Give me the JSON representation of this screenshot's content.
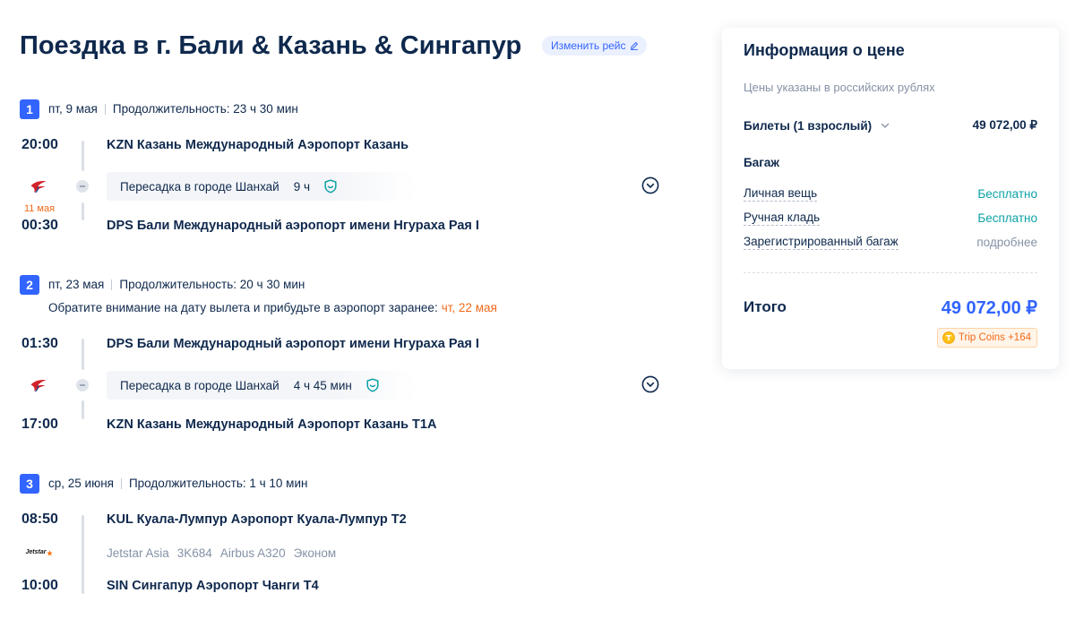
{
  "colors": {
    "text": "#0f294d",
    "muted": "#8592a6",
    "accent": "#3264ff",
    "free": "#0ba1a5",
    "warning": "#f06a1b",
    "line": "#dadfe6"
  },
  "header": {
    "title": "Поездка в г. Бали & Казань & Сингапур",
    "change_flight": "Изменить рейс",
    "change_flight_icon": "pencil-icon"
  },
  "segments": [
    {
      "number": "1",
      "date": "пт, 9 мая",
      "duration": "Продолжительность: 23 ч 30 мин",
      "departure": {
        "time": "20:00",
        "airport": "KZN Казань Международный Аэропорт Казань"
      },
      "airline_logo": "china-eastern-logo",
      "arrival_date_note": "11 мая",
      "layover": {
        "label": "Пересадка в городе Шанхай",
        "duration": "9 ч",
        "icon": "shield-icon"
      },
      "arrival": {
        "time": "00:30",
        "airport": "DPS Бали Международный аэропорт имени Нгураха Рая I"
      }
    },
    {
      "number": "2",
      "date": "пт, 23 мая",
      "duration": "Продолжительность: 20 ч 30 мин",
      "notice": {
        "text": "Обратите внимание на дату вылета и прибудьте в аэропорт заранее:",
        "date": "чт, 22 мая"
      },
      "departure": {
        "time": "01:30",
        "airport": "DPS Бали Международный аэропорт имени Нгураха Рая I"
      },
      "airline_logo": "china-eastern-logo",
      "layover": {
        "label": "Пересадка в городе Шанхай",
        "duration": "4 ч 45 мин",
        "icon": "shield-icon"
      },
      "arrival": {
        "time": "17:00",
        "airport": "KZN Казань Международный Аэропорт Казань T1A"
      }
    },
    {
      "number": "3",
      "date": "ср, 25 июня",
      "duration": "Продолжительность: 1 ч 10 мин",
      "departure": {
        "time": "08:50",
        "airport": "KUL Куала-Лумпур Аэропорт Куала-Лумпур T2"
      },
      "airline_logo": "jetstar-logo",
      "airline_logo_text": "Jetstar",
      "flight": {
        "airline": "Jetstar Asia",
        "number": "3K684",
        "aircraft": "Airbus A320",
        "cabin": "Эконом"
      },
      "arrival": {
        "time": "10:00",
        "airport": "SIN Сингапур Аэропорт Чанги T4"
      }
    }
  ],
  "price": {
    "title": "Информация о цене",
    "currency_note": "Цены указаны в российских рублях",
    "tickets": {
      "label": "Билеты (1 взрослый)",
      "amount": "49 072,00 ₽"
    },
    "baggage_title": "Багаж",
    "baggage": [
      {
        "label": "Личная вещь",
        "value": "Бесплатно"
      },
      {
        "label": "Ручная кладь",
        "value": "Бесплатно"
      },
      {
        "label": "Зарегистрированный багаж",
        "value": "подробнее"
      }
    ],
    "total": {
      "label": "Итого",
      "amount": "49 072,00 ₽"
    },
    "trip_coins": "Trip Coins +164",
    "trip_coins_icon": "coin-icon"
  }
}
